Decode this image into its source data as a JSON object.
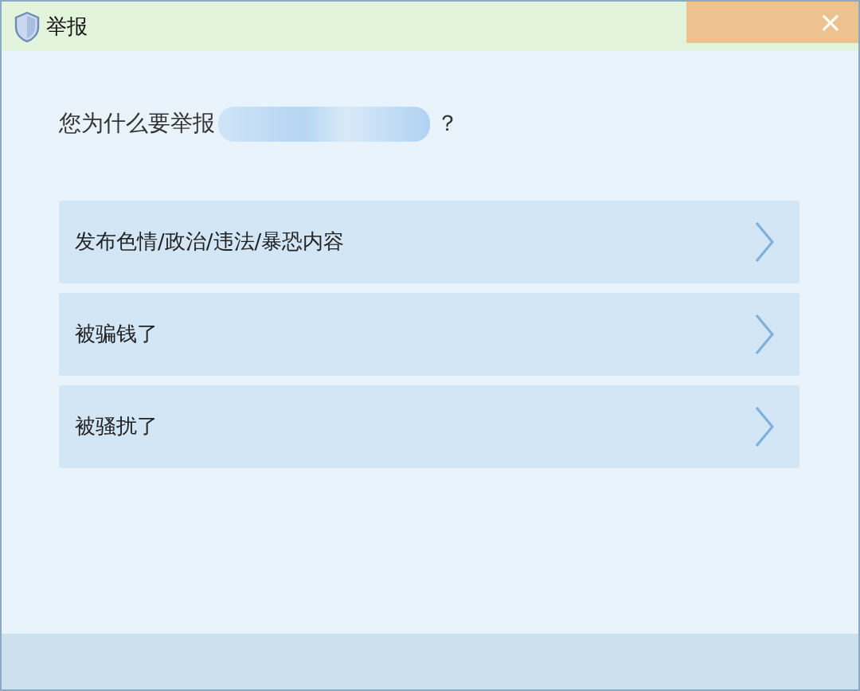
{
  "window": {
    "title": "举报",
    "close": "×"
  },
  "question": {
    "prefix": "您为什么要举报",
    "suffix": "？"
  },
  "options": [
    {
      "label": "发布色情/政治/违法/暴恐内容"
    },
    {
      "label": "被骗钱了"
    },
    {
      "label": "被骚扰了"
    }
  ]
}
